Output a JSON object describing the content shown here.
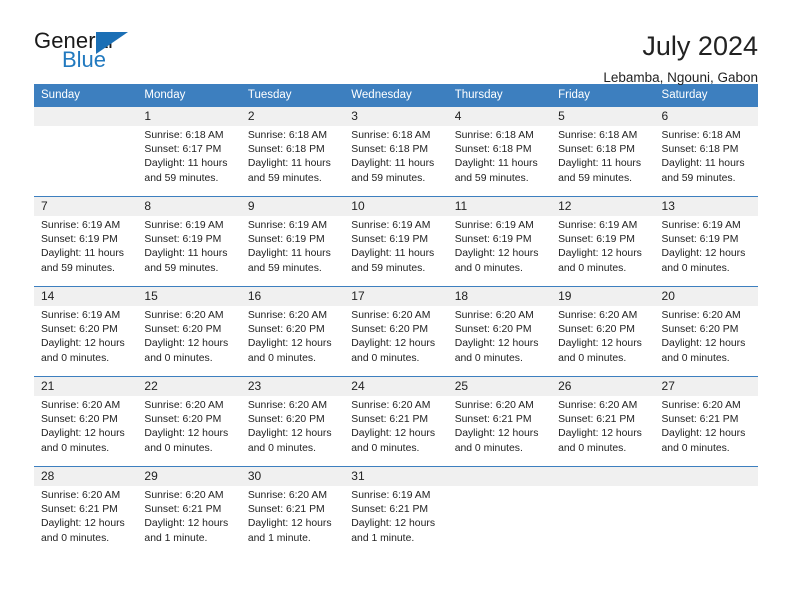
{
  "logo": {
    "text_primary": "General",
    "text_secondary": "Blue",
    "icon": "triangle-icon",
    "colors": {
      "primary": "#1a1a1a",
      "secondary": "#2179bf",
      "triangle": "#1b6fb5"
    }
  },
  "header": {
    "title": "July 2024",
    "subtitle": "Lebamba, Ngouni, Gabon"
  },
  "colors": {
    "header_row_bg": "#3d7fbf",
    "header_row_text": "#ffffff",
    "daynum_bg": "#f0f0f0",
    "cell_bg": "#ffffff",
    "grid_line": "#3d7fbf",
    "text": "#222222"
  },
  "weekdays": [
    "Sunday",
    "Monday",
    "Tuesday",
    "Wednesday",
    "Thursday",
    "Friday",
    "Saturday"
  ],
  "weeks": [
    [
      {
        "day": "",
        "blank": true,
        "sunrise": "",
        "sunset": "",
        "daylight1": "",
        "daylight2": ""
      },
      {
        "day": "1",
        "sunrise": "Sunrise: 6:18 AM",
        "sunset": "Sunset: 6:17 PM",
        "daylight1": "Daylight: 11 hours",
        "daylight2": "and 59 minutes."
      },
      {
        "day": "2",
        "sunrise": "Sunrise: 6:18 AM",
        "sunset": "Sunset: 6:18 PM",
        "daylight1": "Daylight: 11 hours",
        "daylight2": "and 59 minutes."
      },
      {
        "day": "3",
        "sunrise": "Sunrise: 6:18 AM",
        "sunset": "Sunset: 6:18 PM",
        "daylight1": "Daylight: 11 hours",
        "daylight2": "and 59 minutes."
      },
      {
        "day": "4",
        "sunrise": "Sunrise: 6:18 AM",
        "sunset": "Sunset: 6:18 PM",
        "daylight1": "Daylight: 11 hours",
        "daylight2": "and 59 minutes."
      },
      {
        "day": "5",
        "sunrise": "Sunrise: 6:18 AM",
        "sunset": "Sunset: 6:18 PM",
        "daylight1": "Daylight: 11 hours",
        "daylight2": "and 59 minutes."
      },
      {
        "day": "6",
        "sunrise": "Sunrise: 6:18 AM",
        "sunset": "Sunset: 6:18 PM",
        "daylight1": "Daylight: 11 hours",
        "daylight2": "and 59 minutes."
      }
    ],
    [
      {
        "day": "7",
        "sunrise": "Sunrise: 6:19 AM",
        "sunset": "Sunset: 6:19 PM",
        "daylight1": "Daylight: 11 hours",
        "daylight2": "and 59 minutes."
      },
      {
        "day": "8",
        "sunrise": "Sunrise: 6:19 AM",
        "sunset": "Sunset: 6:19 PM",
        "daylight1": "Daylight: 11 hours",
        "daylight2": "and 59 minutes."
      },
      {
        "day": "9",
        "sunrise": "Sunrise: 6:19 AM",
        "sunset": "Sunset: 6:19 PM",
        "daylight1": "Daylight: 11 hours",
        "daylight2": "and 59 minutes."
      },
      {
        "day": "10",
        "sunrise": "Sunrise: 6:19 AM",
        "sunset": "Sunset: 6:19 PM",
        "daylight1": "Daylight: 11 hours",
        "daylight2": "and 59 minutes."
      },
      {
        "day": "11",
        "sunrise": "Sunrise: 6:19 AM",
        "sunset": "Sunset: 6:19 PM",
        "daylight1": "Daylight: 12 hours",
        "daylight2": "and 0 minutes."
      },
      {
        "day": "12",
        "sunrise": "Sunrise: 6:19 AM",
        "sunset": "Sunset: 6:19 PM",
        "daylight1": "Daylight: 12 hours",
        "daylight2": "and 0 minutes."
      },
      {
        "day": "13",
        "sunrise": "Sunrise: 6:19 AM",
        "sunset": "Sunset: 6:19 PM",
        "daylight1": "Daylight: 12 hours",
        "daylight2": "and 0 minutes."
      }
    ],
    [
      {
        "day": "14",
        "sunrise": "Sunrise: 6:19 AM",
        "sunset": "Sunset: 6:20 PM",
        "daylight1": "Daylight: 12 hours",
        "daylight2": "and 0 minutes."
      },
      {
        "day": "15",
        "sunrise": "Sunrise: 6:20 AM",
        "sunset": "Sunset: 6:20 PM",
        "daylight1": "Daylight: 12 hours",
        "daylight2": "and 0 minutes."
      },
      {
        "day": "16",
        "sunrise": "Sunrise: 6:20 AM",
        "sunset": "Sunset: 6:20 PM",
        "daylight1": "Daylight: 12 hours",
        "daylight2": "and 0 minutes."
      },
      {
        "day": "17",
        "sunrise": "Sunrise: 6:20 AM",
        "sunset": "Sunset: 6:20 PM",
        "daylight1": "Daylight: 12 hours",
        "daylight2": "and 0 minutes."
      },
      {
        "day": "18",
        "sunrise": "Sunrise: 6:20 AM",
        "sunset": "Sunset: 6:20 PM",
        "daylight1": "Daylight: 12 hours",
        "daylight2": "and 0 minutes."
      },
      {
        "day": "19",
        "sunrise": "Sunrise: 6:20 AM",
        "sunset": "Sunset: 6:20 PM",
        "daylight1": "Daylight: 12 hours",
        "daylight2": "and 0 minutes."
      },
      {
        "day": "20",
        "sunrise": "Sunrise: 6:20 AM",
        "sunset": "Sunset: 6:20 PM",
        "daylight1": "Daylight: 12 hours",
        "daylight2": "and 0 minutes."
      }
    ],
    [
      {
        "day": "21",
        "sunrise": "Sunrise: 6:20 AM",
        "sunset": "Sunset: 6:20 PM",
        "daylight1": "Daylight: 12 hours",
        "daylight2": "and 0 minutes."
      },
      {
        "day": "22",
        "sunrise": "Sunrise: 6:20 AM",
        "sunset": "Sunset: 6:20 PM",
        "daylight1": "Daylight: 12 hours",
        "daylight2": "and 0 minutes."
      },
      {
        "day": "23",
        "sunrise": "Sunrise: 6:20 AM",
        "sunset": "Sunset: 6:20 PM",
        "daylight1": "Daylight: 12 hours",
        "daylight2": "and 0 minutes."
      },
      {
        "day": "24",
        "sunrise": "Sunrise: 6:20 AM",
        "sunset": "Sunset: 6:21 PM",
        "daylight1": "Daylight: 12 hours",
        "daylight2": "and 0 minutes."
      },
      {
        "day": "25",
        "sunrise": "Sunrise: 6:20 AM",
        "sunset": "Sunset: 6:21 PM",
        "daylight1": "Daylight: 12 hours",
        "daylight2": "and 0 minutes."
      },
      {
        "day": "26",
        "sunrise": "Sunrise: 6:20 AM",
        "sunset": "Sunset: 6:21 PM",
        "daylight1": "Daylight: 12 hours",
        "daylight2": "and 0 minutes."
      },
      {
        "day": "27",
        "sunrise": "Sunrise: 6:20 AM",
        "sunset": "Sunset: 6:21 PM",
        "daylight1": "Daylight: 12 hours",
        "daylight2": "and 0 minutes."
      }
    ],
    [
      {
        "day": "28",
        "sunrise": "Sunrise: 6:20 AM",
        "sunset": "Sunset: 6:21 PM",
        "daylight1": "Daylight: 12 hours",
        "daylight2": "and 0 minutes."
      },
      {
        "day": "29",
        "sunrise": "Sunrise: 6:20 AM",
        "sunset": "Sunset: 6:21 PM",
        "daylight1": "Daylight: 12 hours",
        "daylight2": "and 1 minute."
      },
      {
        "day": "30",
        "sunrise": "Sunrise: 6:20 AM",
        "sunset": "Sunset: 6:21 PM",
        "daylight1": "Daylight: 12 hours",
        "daylight2": "and 1 minute."
      },
      {
        "day": "31",
        "sunrise": "Sunrise: 6:19 AM",
        "sunset": "Sunset: 6:21 PM",
        "daylight1": "Daylight: 12 hours",
        "daylight2": "and 1 minute."
      },
      {
        "day": "",
        "blank": true,
        "sunrise": "",
        "sunset": "",
        "daylight1": "",
        "daylight2": ""
      },
      {
        "day": "",
        "blank": true,
        "sunrise": "",
        "sunset": "",
        "daylight1": "",
        "daylight2": ""
      },
      {
        "day": "",
        "blank": true,
        "sunrise": "",
        "sunset": "",
        "daylight1": "",
        "daylight2": ""
      }
    ]
  ]
}
